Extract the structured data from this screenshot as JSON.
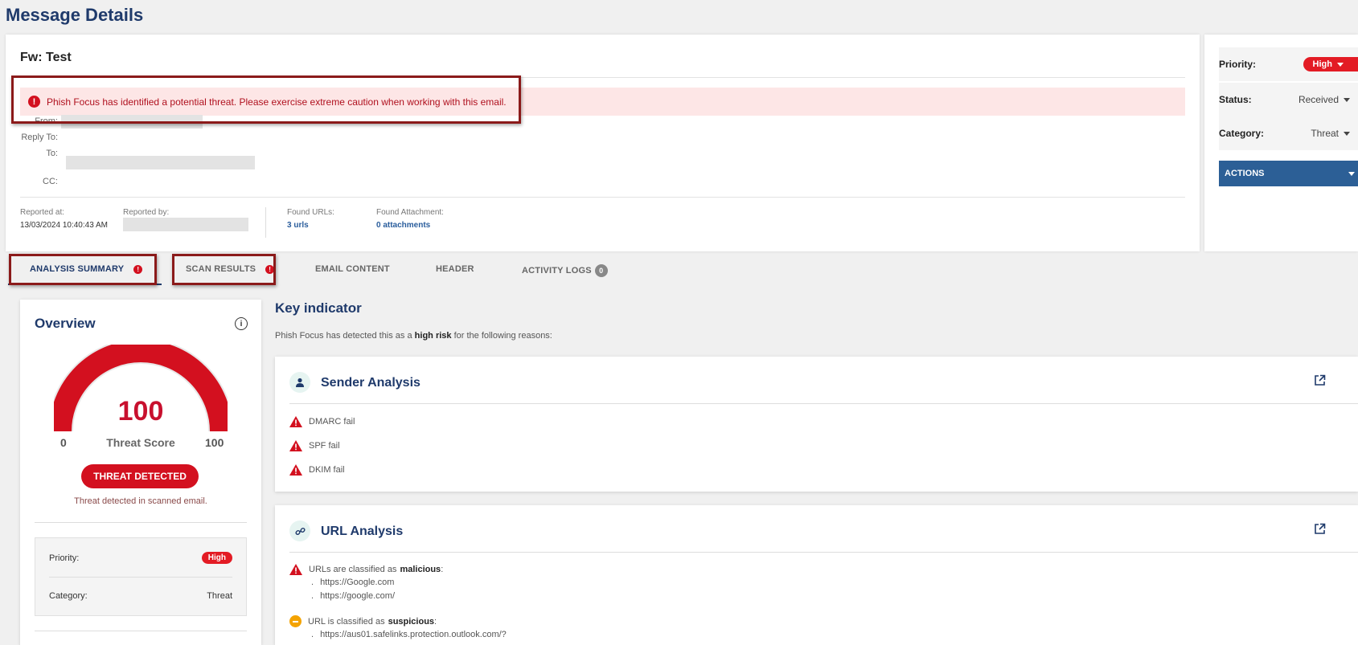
{
  "page": {
    "title": "Message Details"
  },
  "message": {
    "subject": "Fw: Test",
    "alert": "Phish Focus has identified a potential threat. Please exercise extreme caution when working with this email.",
    "fields": {
      "from": "From:",
      "reply_to": "Reply To:",
      "to": "To:",
      "cc": "CC:"
    },
    "meta": {
      "reported_at_label": "Reported at:",
      "reported_at": "13/03/2024 10:40:43 AM",
      "reported_by_label": "Reported by:",
      "found_urls_label": "Found URLs:",
      "found_urls": "3 urls",
      "found_attachment_label": "Found Attachment:",
      "found_attachment": "0 attachments"
    }
  },
  "side": {
    "priority_label": "Priority:",
    "priority": "High",
    "status_label": "Status:",
    "status": "Received",
    "category_label": "Category:",
    "category": "Threat",
    "actions": "ACTIONS"
  },
  "tabs": [
    {
      "label": "ANALYSIS SUMMARY",
      "badge": "!"
    },
    {
      "label": "SCAN RESULTS",
      "badge": "!"
    },
    {
      "label": "EMAIL CONTENT"
    },
    {
      "label": "HEADER"
    },
    {
      "label": "ACTIVITY LOGS",
      "count": "0"
    }
  ],
  "overview": {
    "title": "Overview",
    "score": "100",
    "score_label": "Threat Score",
    "min": "0",
    "max": "100",
    "score_value": 100,
    "status_button": "THREAT DETECTED",
    "note": "Threat detected in scanned email.",
    "priority_label": "Priority:",
    "priority": "High",
    "category_label": "Category:",
    "category": "Threat"
  },
  "key_indicator": {
    "title": "Key indicator",
    "desc_pre": "Phish Focus has detected this as a",
    "desc_bold": "high risk",
    "desc_post": "for the following reasons:"
  },
  "sender_analysis": {
    "title": "Sender Analysis",
    "reasons": [
      "DMARC fail",
      "SPF fail",
      "DKIM fail"
    ]
  },
  "url_analysis": {
    "title": "URL Analysis",
    "malicious_pre": "URLs are classified as",
    "malicious_bold": "malicious",
    "malicious_urls": [
      "https://Google.com",
      "https://google.com/"
    ],
    "suspicious_pre": "URL is classified as",
    "suspicious_bold": "suspicious",
    "suspicious_urls": [
      "https://aus01.safelinks.protection.outlook.com/?"
    ]
  },
  "colors": {
    "brand": "#1f3a6b",
    "danger": "#d3101f",
    "action": "#2c5f96",
    "warn": "#f4a300"
  }
}
